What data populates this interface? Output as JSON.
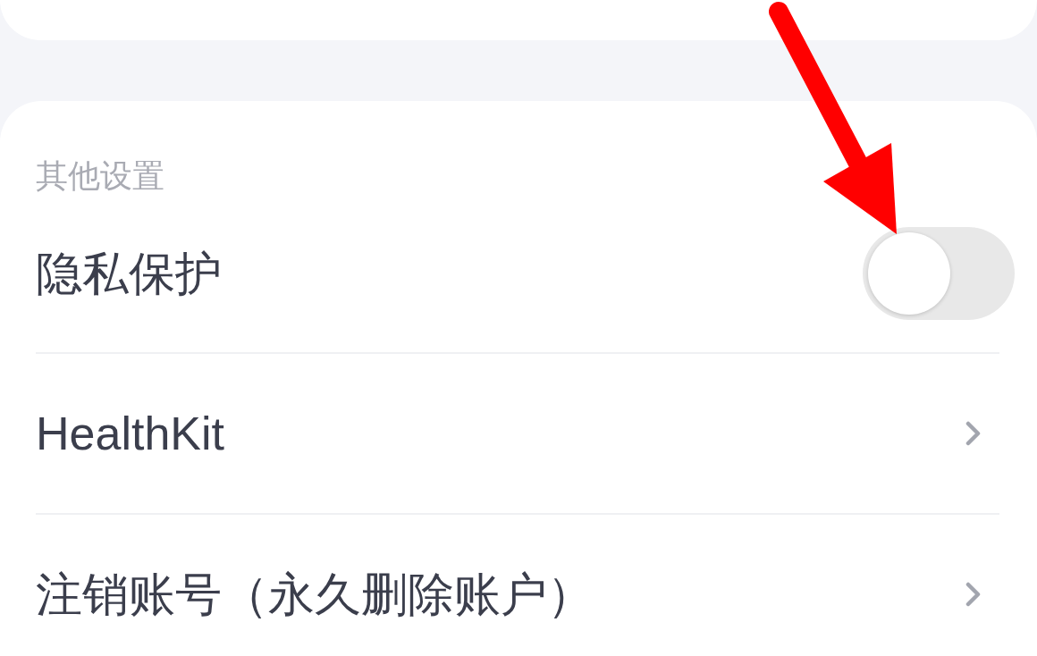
{
  "sections": [
    {
      "title": "其他设置",
      "rows": [
        {
          "kind": "toggle",
          "label": "隐私保护",
          "on": false
        },
        {
          "kind": "link",
          "label": "HealthKit"
        },
        {
          "kind": "link",
          "label": "注销账号（永久删除账户）"
        }
      ]
    }
  ]
}
